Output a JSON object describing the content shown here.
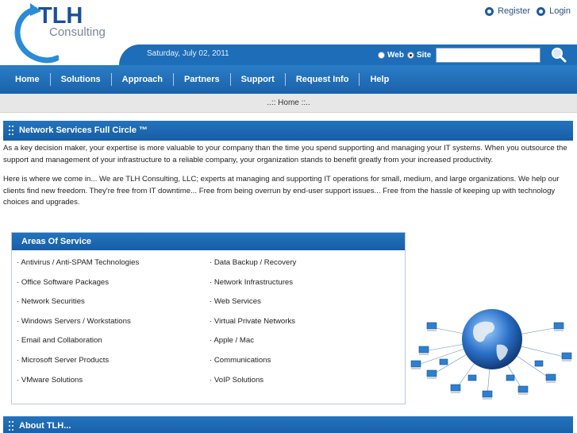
{
  "header": {
    "logo_main": "TLH",
    "logo_sub": "Consulting",
    "register_label": "Register",
    "login_label": "Login",
    "date": "Saturday, July 02, 2011",
    "search": {
      "option_web": "Web",
      "option_site": "Site",
      "selected": "Site",
      "value": "",
      "button_icon": "magnifier-icon"
    }
  },
  "nav": {
    "items": [
      "Home",
      "Solutions",
      "Approach",
      "Partners",
      "Support",
      "Request Info",
      "Help"
    ]
  },
  "breadcrumb": "..:: Home ::..",
  "section1": {
    "title": "Network Services Full Circle ™",
    "para1": "As a key decision maker, your expertise is more valuable to your company than the time you spend supporting and managing your IT systems. When you outsource the support and management of your infrastructure to a reliable company, your organization stands to benefit greatly from your increased productivity.",
    "para2": "Here is where we come in...  We are TLH Consulting, LLC; experts at managing and supporting IT operations for small, medium, and large organizations. We help our clients find new freedom. They're free from IT downtime... Free from being overrun by end-user support issues... Free from the hassle of keeping up with technology choices and upgrades."
  },
  "areas": {
    "title": "Areas Of Service",
    "left": [
      "· Antivirus / Anti-SPAM Technologies",
      "· Office Software Packages",
      "· Network Securities",
      "· Windows Servers / Workstations",
      "· Email and Collaboration",
      "· Microsoft Server Products",
      "· VMware Solutions"
    ],
    "right": [
      "· Data Backup / Recovery",
      "· Network Infrastructures",
      "· Web Services",
      "· Virtual Private Networks",
      "· Apple / Mac",
      "· Communications",
      "· VoIP Solutions"
    ]
  },
  "section2": {
    "title": "About TLH..."
  },
  "colors": {
    "brand_blue": "#1d6db8",
    "nav_blue": "#1a62ab",
    "logo_blue": "#1a4f9c"
  }
}
